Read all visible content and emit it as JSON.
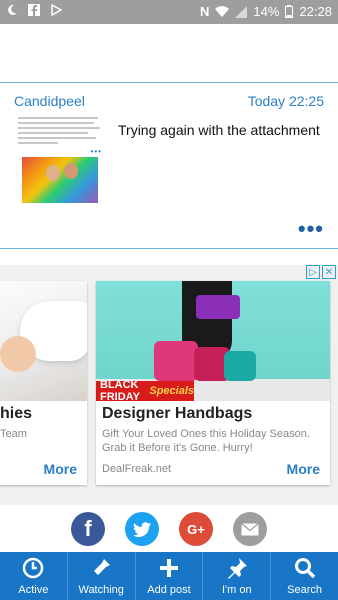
{
  "status_bar": {
    "battery": "14%",
    "time": "22:28"
  },
  "post": {
    "author": "Candidpeel",
    "timestamp": "Today 22:25",
    "text": "Trying again with the attachment"
  },
  "ads": {
    "left_card": {
      "title": "hies",
      "desc": "Team",
      "more": "More"
    },
    "right_card": {
      "badge_a": "BLACK FRIDAY",
      "badge_b": "Specials",
      "title": "Designer Handbags",
      "desc": "Gift Your Loved Ones this Holiday Season. Grab it Before it's Gone. Hurry!",
      "source": "DealFreak.net",
      "more": "More"
    }
  },
  "share": {
    "facebook_glyph": "f",
    "googleplus_glyph": "G+"
  },
  "nav": {
    "items": [
      {
        "label": "Active",
        "icon": "clock-icon"
      },
      {
        "label": "Watching",
        "icon": "flashlight-icon"
      },
      {
        "label": "Add post",
        "icon": "plus-icon"
      },
      {
        "label": "I'm on",
        "icon": "pin-icon"
      },
      {
        "label": "Search",
        "icon": "search-icon"
      }
    ]
  },
  "colors": {
    "accent": "#2a7fc9",
    "nav_bg": "#1976c7",
    "facebook": "#3b5998",
    "twitter": "#1da1f2",
    "googleplus": "#dd4b39"
  }
}
